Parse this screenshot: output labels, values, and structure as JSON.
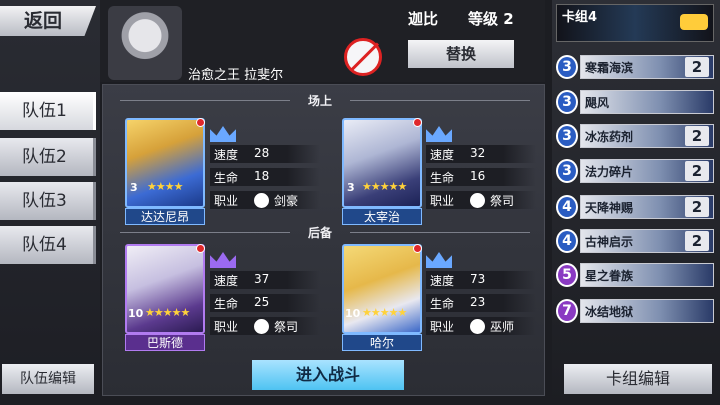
{
  "nav": {
    "back_label": "返回"
  },
  "teams": [
    "队伍1",
    "队伍2",
    "队伍3",
    "队伍4"
  ],
  "team_edit_label": "队伍编辑",
  "header": {
    "player_name": "迦比",
    "level_text": "等级 2",
    "title": "治愈之王 拉斐尔",
    "swap_label": "替换"
  },
  "sections": {
    "onfield": "场上",
    "reserve": "后备"
  },
  "stat_labels": {
    "speed": "速度",
    "hp": "生命",
    "job": "职业"
  },
  "cards": [
    {
      "name": "达达尼昂",
      "level": "3",
      "stars": 4,
      "speed": "28",
      "hp": "18",
      "job": "剑豪",
      "frame_color": "#7fb9ff",
      "job_icon": "sword-class-icon"
    },
    {
      "name": "太宰治",
      "level": "3",
      "stars": 5,
      "speed": "32",
      "hp": "16",
      "job": "祭司",
      "frame_color": "#7fb9ff",
      "job_icon": "cross-class-icon"
    },
    {
      "name": "巴斯德",
      "level": "10",
      "stars": 5,
      "speed": "37",
      "hp": "25",
      "job": "祭司",
      "frame_color": "#b17bf0",
      "job_icon": "cross-class-icon"
    },
    {
      "name": "哈尔",
      "level": "10",
      "stars": 5,
      "speed": "73",
      "hp": "23",
      "job": "巫师",
      "frame_color": "#7fb9ff",
      "job_icon": "staff-class-icon"
    }
  ],
  "battle_label": "进入战斗",
  "deck": {
    "title": "卡组4",
    "edit_label": "卡组编辑",
    "cards": [
      {
        "cost": "3",
        "name": "寒霜海滨",
        "count": "2"
      },
      {
        "cost": "3",
        "name": "飓风",
        "count": ""
      },
      {
        "cost": "3",
        "name": "冰冻药剂",
        "count": "2"
      },
      {
        "cost": "3",
        "name": "法力碎片",
        "count": "2"
      },
      {
        "cost": "4",
        "name": "天降神赐",
        "count": "2"
      },
      {
        "cost": "4",
        "name": "古神启示",
        "count": "2"
      },
      {
        "cost": "5",
        "name": "星之眷族",
        "count": ""
      },
      {
        "cost": "7",
        "name": "冰结地狱",
        "count": ""
      }
    ]
  },
  "colors": {
    "accent_blue": "#4ec3f2",
    "red_dot": "#e0282b",
    "gold": "#ffd23a"
  }
}
